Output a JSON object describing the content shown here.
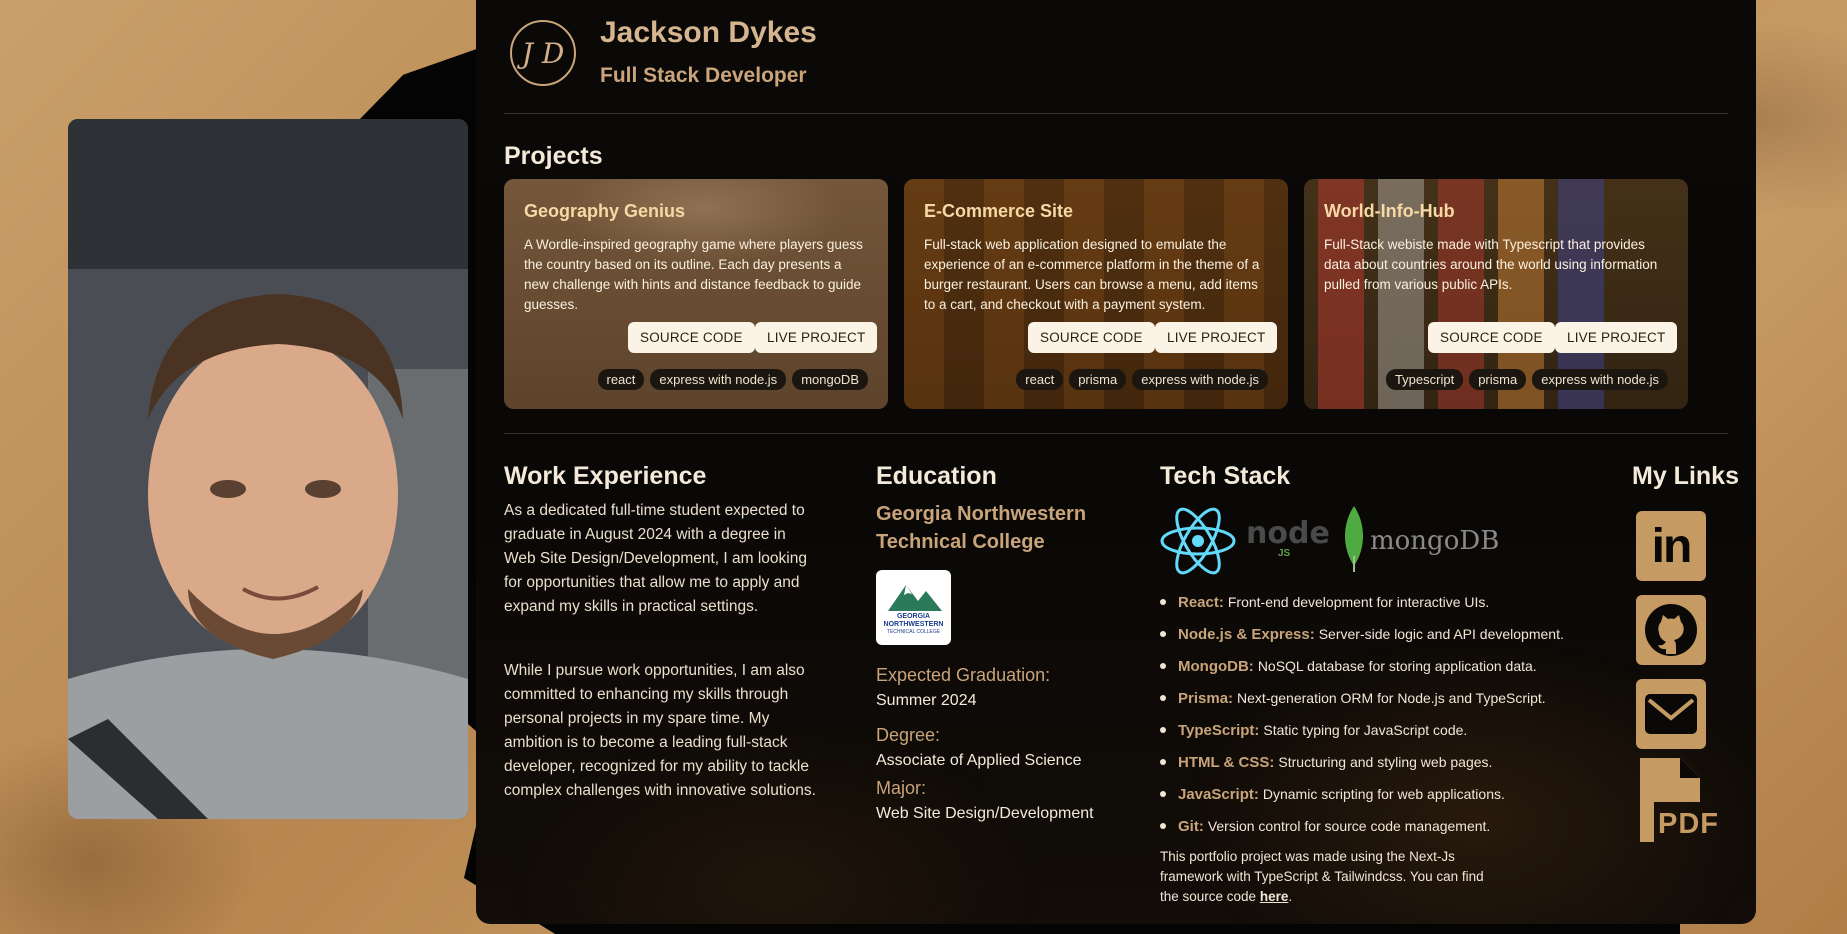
{
  "header": {
    "logo_text": "J D",
    "name": "Jackson Dykes",
    "role": "Full Stack Developer"
  },
  "projects": {
    "heading": "Projects",
    "items": [
      {
        "title": "Geography Genius",
        "description": "A Wordle-inspired geography game where players guess the country based on its outline. Each day presents a new challenge with hints and distance feedback to guide guesses.",
        "source_label": "SOURCE CODE",
        "live_label": "LIVE PROJECT",
        "tags": [
          "react",
          "express with node.js",
          "mongoDB"
        ]
      },
      {
        "title": "E-Commerce Site",
        "description": "Full-stack web application designed to emulate the experience of an e-commerce platform in the theme of a burger restaurant. Users can browse a menu, add items to a cart, and checkout with a payment system.",
        "source_label": "SOURCE CODE",
        "live_label": "LIVE PROJECT",
        "tags": [
          "react",
          "prisma",
          "express with node.js"
        ]
      },
      {
        "title": "World-Info-Hub",
        "description": "Full-Stack webiste made with Typescript that provides data about countries around the world using information pulled from various public APIs.",
        "source_label": "SOURCE CODE",
        "live_label": "LIVE PROJECT",
        "tags": [
          "Typescript",
          "prisma",
          "express with node.js"
        ]
      }
    ]
  },
  "work": {
    "heading": "Work Experience",
    "p1": "As a dedicated full-time student expected to graduate in August 2024 with a degree in Web Site Design/Development, I am looking for opportunities that allow me to apply and expand my skills in practical settings.",
    "p2": "While I pursue work opportunities, I am also committed to enhancing my skills through personal projects in my spare time. My ambition is to become a leading full-stack developer, recognized for my ability to tackle complex challenges with innovative solutions."
  },
  "education": {
    "heading": "Education",
    "school": "Georgia Northwestern Technical College",
    "logo_line1": "GEORGIA",
    "logo_line2": "NORTHWESTERN",
    "logo_line3": "TECHNICAL COLLEGE",
    "grad_label": "Expected Graduation:",
    "grad_value": "Summer 2024",
    "degree_label": "Degree:",
    "degree_value": "Associate of Applied Science",
    "major_label": "Major:",
    "major_value": "Web Site Design/Development"
  },
  "tech": {
    "heading": "Tech Stack",
    "node_logo_text": "node",
    "node_logo_sub": "JS",
    "mongo_logo_text": "mongoDB",
    "items": [
      {
        "name": "React:",
        "desc": "Front-end development for interactive UIs."
      },
      {
        "name": "Node.js & Express:",
        "desc": "Server-side logic and API development."
      },
      {
        "name": "MongoDB:",
        "desc": "NoSQL database for storing application data."
      },
      {
        "name": "Prisma:",
        "desc": "Next-generation ORM for Node.js and TypeScript."
      },
      {
        "name": "TypeScript:",
        "desc": "Static typing for JavaScript code."
      },
      {
        "name": "HTML & CSS:",
        "desc": "Structuring and styling web pages."
      },
      {
        "name": "JavaScript:",
        "desc": "Dynamic scripting for web applications."
      },
      {
        "name": "Git:",
        "desc": "Version control for source code management."
      }
    ],
    "footnote": "This portfolio project was made using the Next-Js framework with TypeScript & Tailwindcss. You can find the source code ",
    "footnote_link": "here",
    "footnote_end": "."
  },
  "links": {
    "heading": "My Links",
    "icons": [
      "linkedin-icon",
      "github-icon",
      "email-icon",
      "pdf-icon"
    ],
    "linkedin_text": "in",
    "pdf_text": "PDF"
  },
  "colors": {
    "accent": "#c9a47a",
    "panel": "#0a0806",
    "button_bg": "#fbf3e6"
  }
}
